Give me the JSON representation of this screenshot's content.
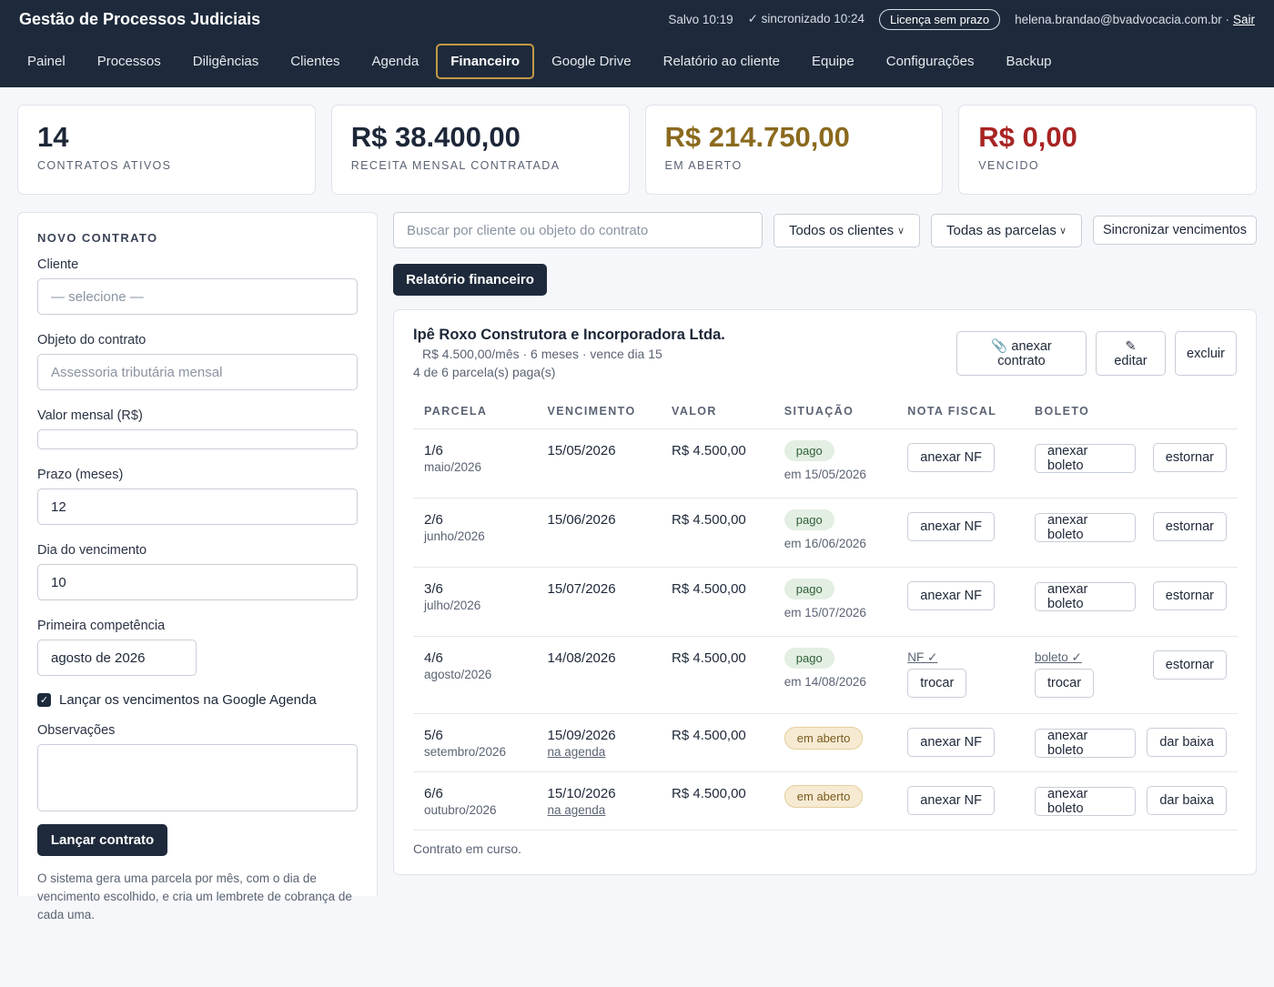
{
  "header": {
    "title": "Gestão de Processos Judiciais",
    "saved": "Salvo 10:19",
    "synced": "✓ sincronizado 10:24",
    "license": "Licença sem prazo",
    "user": "helena.brandao@bvadvocacia.com.br ·",
    "logout": "Sair"
  },
  "nav": [
    "Painel",
    "Processos",
    "Diligências",
    "Clientes",
    "Agenda",
    "Financeiro",
    "Google Drive",
    "Relatório ao cliente",
    "Equipe",
    "Configurações",
    "Backup"
  ],
  "nav_active": "Financeiro",
  "stats": [
    {
      "value": "14",
      "label": "CONTRATOS ATIVOS",
      "color": "#1d2738"
    },
    {
      "value": "R$ 38.400,00",
      "label": "RECEITA MENSAL CONTRATADA",
      "color": "#1d2738"
    },
    {
      "value": "R$ 214.750,00",
      "label": "EM ABERTO",
      "color": "#8a6a1e"
    },
    {
      "value": "R$ 0,00",
      "label": "VENCIDO",
      "color": "#a82424"
    }
  ],
  "form": {
    "title": "NOVO CONTRATO",
    "client_label": "Cliente",
    "client_placeholder": "— selecione —",
    "object_label": "Objeto do contrato",
    "object_placeholder": "Assessoria tributária mensal",
    "value_label": "Valor mensal (R$)",
    "value": "",
    "term_label": "Prazo (meses)",
    "term": "12",
    "due_label": "Dia do vencimento",
    "due": "10",
    "first_label": "Primeira competência",
    "first": "agosto de 2026",
    "calendar_check": "Lançar os vencimentos na Google Agenda",
    "calendar_checked": true,
    "notes_label": "Observações",
    "submit": "Lançar contrato",
    "hint": "O sistema gera uma parcela por mês, com o dia de vencimento escolhido, e cria um lembrete de cobrança de cada uma."
  },
  "toolbar": {
    "search_placeholder": "Buscar por cliente ou objeto do contrato",
    "client_filter": "Todos os clientes",
    "installment_filter": "Todas as parcelas",
    "sync_button": "Sincronizar vencimentos",
    "report_button": "Relatório financeiro"
  },
  "contract": {
    "name": "Ipê Roxo Construtora e Incorporadora Ltda.",
    "meta": "R$ 4.500,00/mês · 6 meses · vence dia 15",
    "paid": "4 de 6 parcela(s) paga(s)",
    "attach_icon": "📎",
    "attach_label": "anexar",
    "attach_label2": "contrato",
    "edit_icon": "✎",
    "edit_label": "editar",
    "delete_label": "excluir",
    "columns": [
      "PARCELA",
      "VENCIMENTO",
      "VALOR",
      "SITUAÇÃO",
      "NOTA FISCAL",
      "BOLETO"
    ],
    "rows": [
      {
        "parcela": "1/6",
        "mes": "maio/2026",
        "vencimento": "15/05/2026",
        "agenda": "",
        "valor": "R$ 4.500,00",
        "status": "pago",
        "status_sub": "em 15/05/2026",
        "nf_done": "",
        "nf_btn": "anexar NF",
        "boleto_done": "",
        "boleto_btn": "anexar boleto",
        "action": "estornar"
      },
      {
        "parcela": "2/6",
        "mes": "junho/2026",
        "vencimento": "15/06/2026",
        "agenda": "",
        "valor": "R$ 4.500,00",
        "status": "pago",
        "status_sub": "em 16/06/2026",
        "nf_done": "",
        "nf_btn": "anexar NF",
        "boleto_done": "",
        "boleto_btn": "anexar boleto",
        "action": "estornar"
      },
      {
        "parcela": "3/6",
        "mes": "julho/2026",
        "vencimento": "15/07/2026",
        "agenda": "",
        "valor": "R$ 4.500,00",
        "status": "pago",
        "status_sub": "em 15/07/2026",
        "nf_done": "",
        "nf_btn": "anexar NF",
        "boleto_done": "",
        "boleto_btn": "anexar boleto",
        "action": "estornar"
      },
      {
        "parcela": "4/6",
        "mes": "agosto/2026",
        "vencimento": "14/08/2026",
        "agenda": "",
        "valor": "R$ 4.500,00",
        "status": "pago",
        "status_sub": "em 14/08/2026",
        "nf_done": "NF ✓",
        "nf_btn": "trocar",
        "boleto_done": "boleto ✓",
        "boleto_btn": "trocar",
        "action": "estornar"
      },
      {
        "parcela": "5/6",
        "mes": "setembro/2026",
        "vencimento": "15/09/2026",
        "agenda": "na agenda",
        "valor": "R$ 4.500,00",
        "status": "em aberto",
        "status_sub": "",
        "nf_done": "",
        "nf_btn": "anexar NF",
        "boleto_done": "",
        "boleto_btn": "anexar boleto",
        "action": "dar baixa"
      },
      {
        "parcela": "6/6",
        "mes": "outubro/2026",
        "vencimento": "15/10/2026",
        "agenda": "na agenda",
        "valor": "R$ 4.500,00",
        "status": "em aberto",
        "status_sub": "",
        "nf_done": "",
        "nf_btn": "anexar NF",
        "boleto_done": "",
        "boleto_btn": "anexar boleto",
        "action": "dar baixa"
      }
    ],
    "footer": "Contrato em curso."
  }
}
